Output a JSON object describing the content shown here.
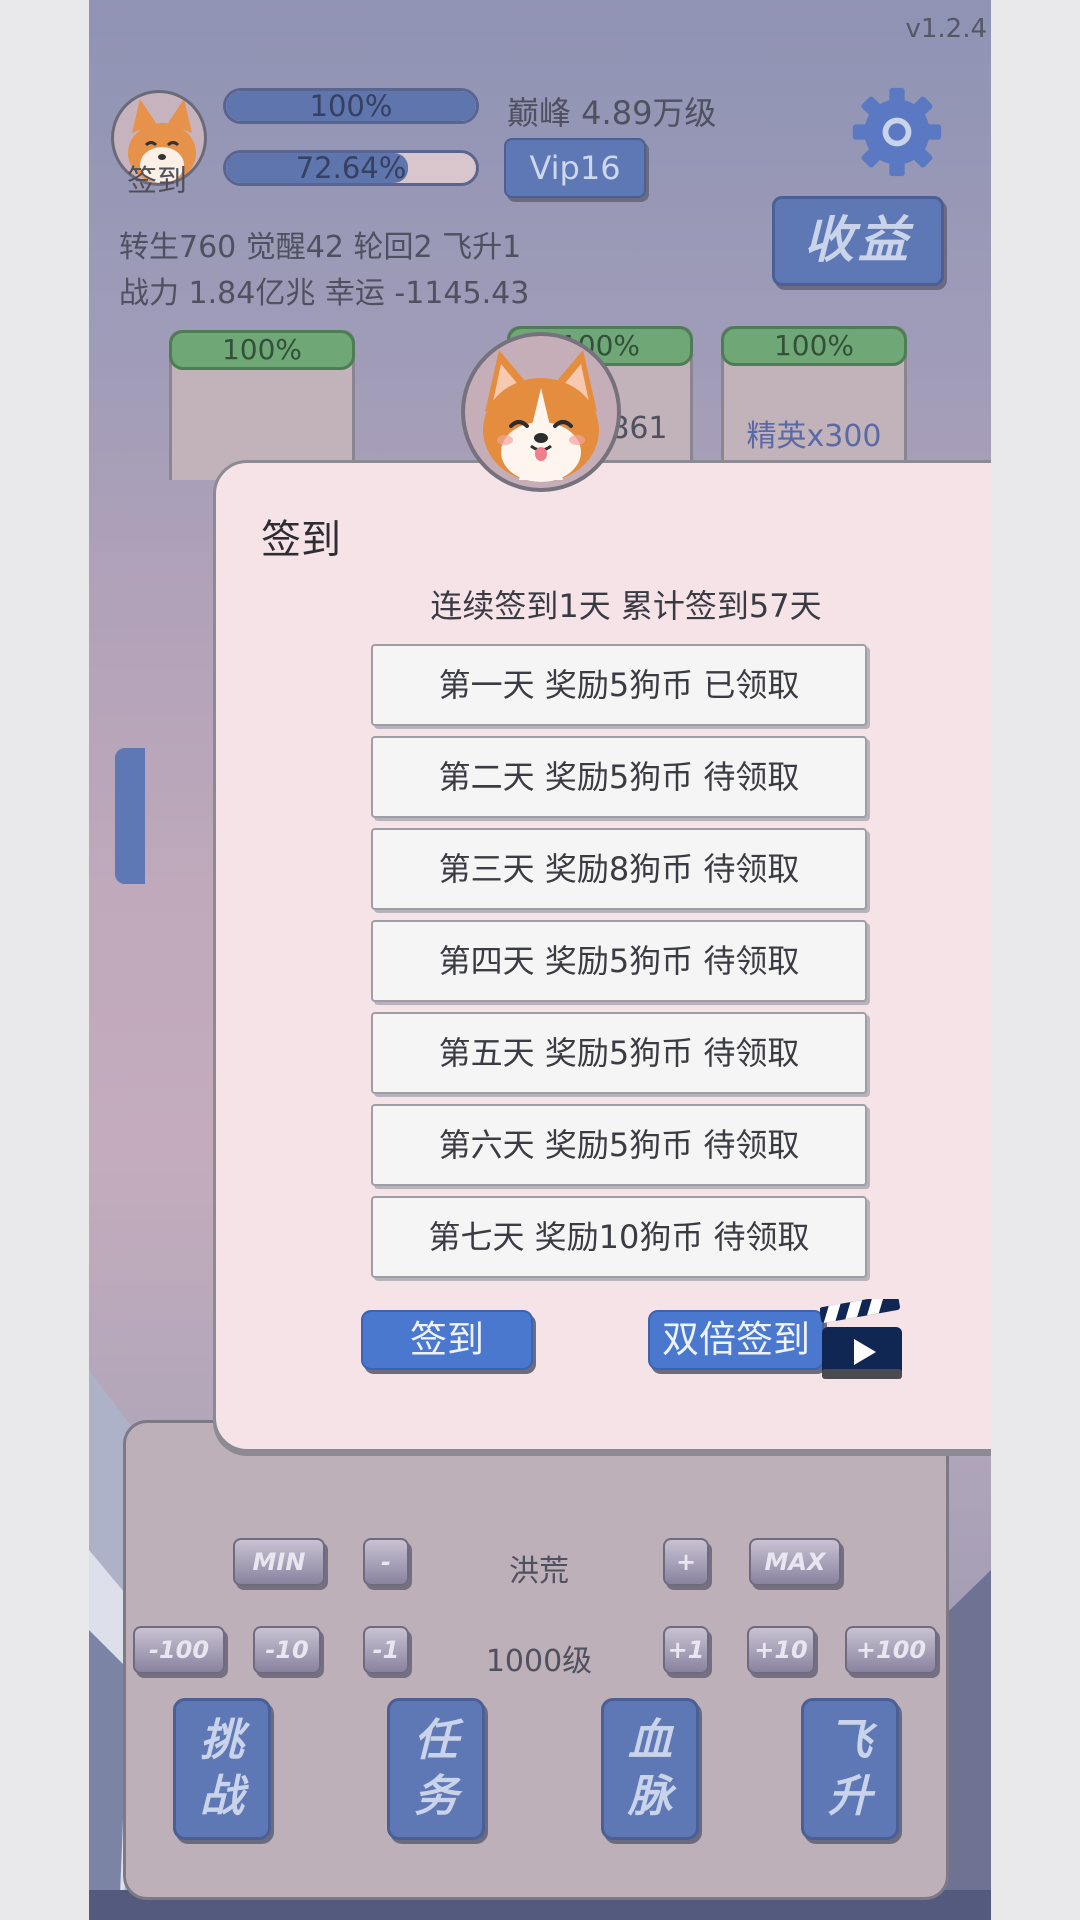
{
  "version": "v1.2.4",
  "header": {
    "avatar_label": "签到",
    "bar1_percent": "100%",
    "bar1_fill": 1.0,
    "bar2_percent": "72.64%",
    "bar2_fill": 0.7264,
    "peak_text": "巅峰 4.89万级",
    "vip_label": "Vip16",
    "income_label": "收益",
    "stats_line1": "转生760 觉醒42 轮回2 飞升1",
    "stats_line2": "战力 1.84亿兆  幸运 -1145.43"
  },
  "cards": [
    {
      "percent": "100%",
      "label": ""
    },
    {
      "percent": "100%",
      "label": "x861"
    },
    {
      "percent": "100%",
      "label": "精英x300"
    }
  ],
  "controls": {
    "min_label": "MIN",
    "minus_label": "-",
    "realm": "洪荒",
    "plus_label": "+",
    "max_label": "MAX",
    "m100": "-100",
    "m10": "-10",
    "m1": "-1",
    "level": "1000级",
    "p1": "+1",
    "p10": "+10",
    "p100": "+100"
  },
  "bottom_buttons": [
    "挑\n战",
    "任\n务",
    "血\n脉",
    "飞\n升"
  ],
  "dialog": {
    "title": "签到",
    "summary": "连续签到1天    累计签到57天",
    "rewards": [
      "第一天 奖励5狗币 已领取",
      "第二天 奖励5狗币 待领取",
      "第三天 奖励8狗币 待领取",
      "第四天 奖励5狗币 待领取",
      "第五天 奖励5狗币 待领取",
      "第六天 奖励5狗币 待领取",
      "第七天 奖励10狗币 待领取"
    ],
    "sign_label": "签到",
    "double_sign_label": "双倍签到"
  },
  "icons": {
    "settings": "gear-icon",
    "video": "clapperboard-play-icon",
    "avatar": "corgi-icon"
  },
  "colors": {
    "accent_blue": "#4b78cf",
    "dialog_bg": "#f6e3e8",
    "progress_green": "#6fa876",
    "button_blue": "#5e77b5"
  }
}
